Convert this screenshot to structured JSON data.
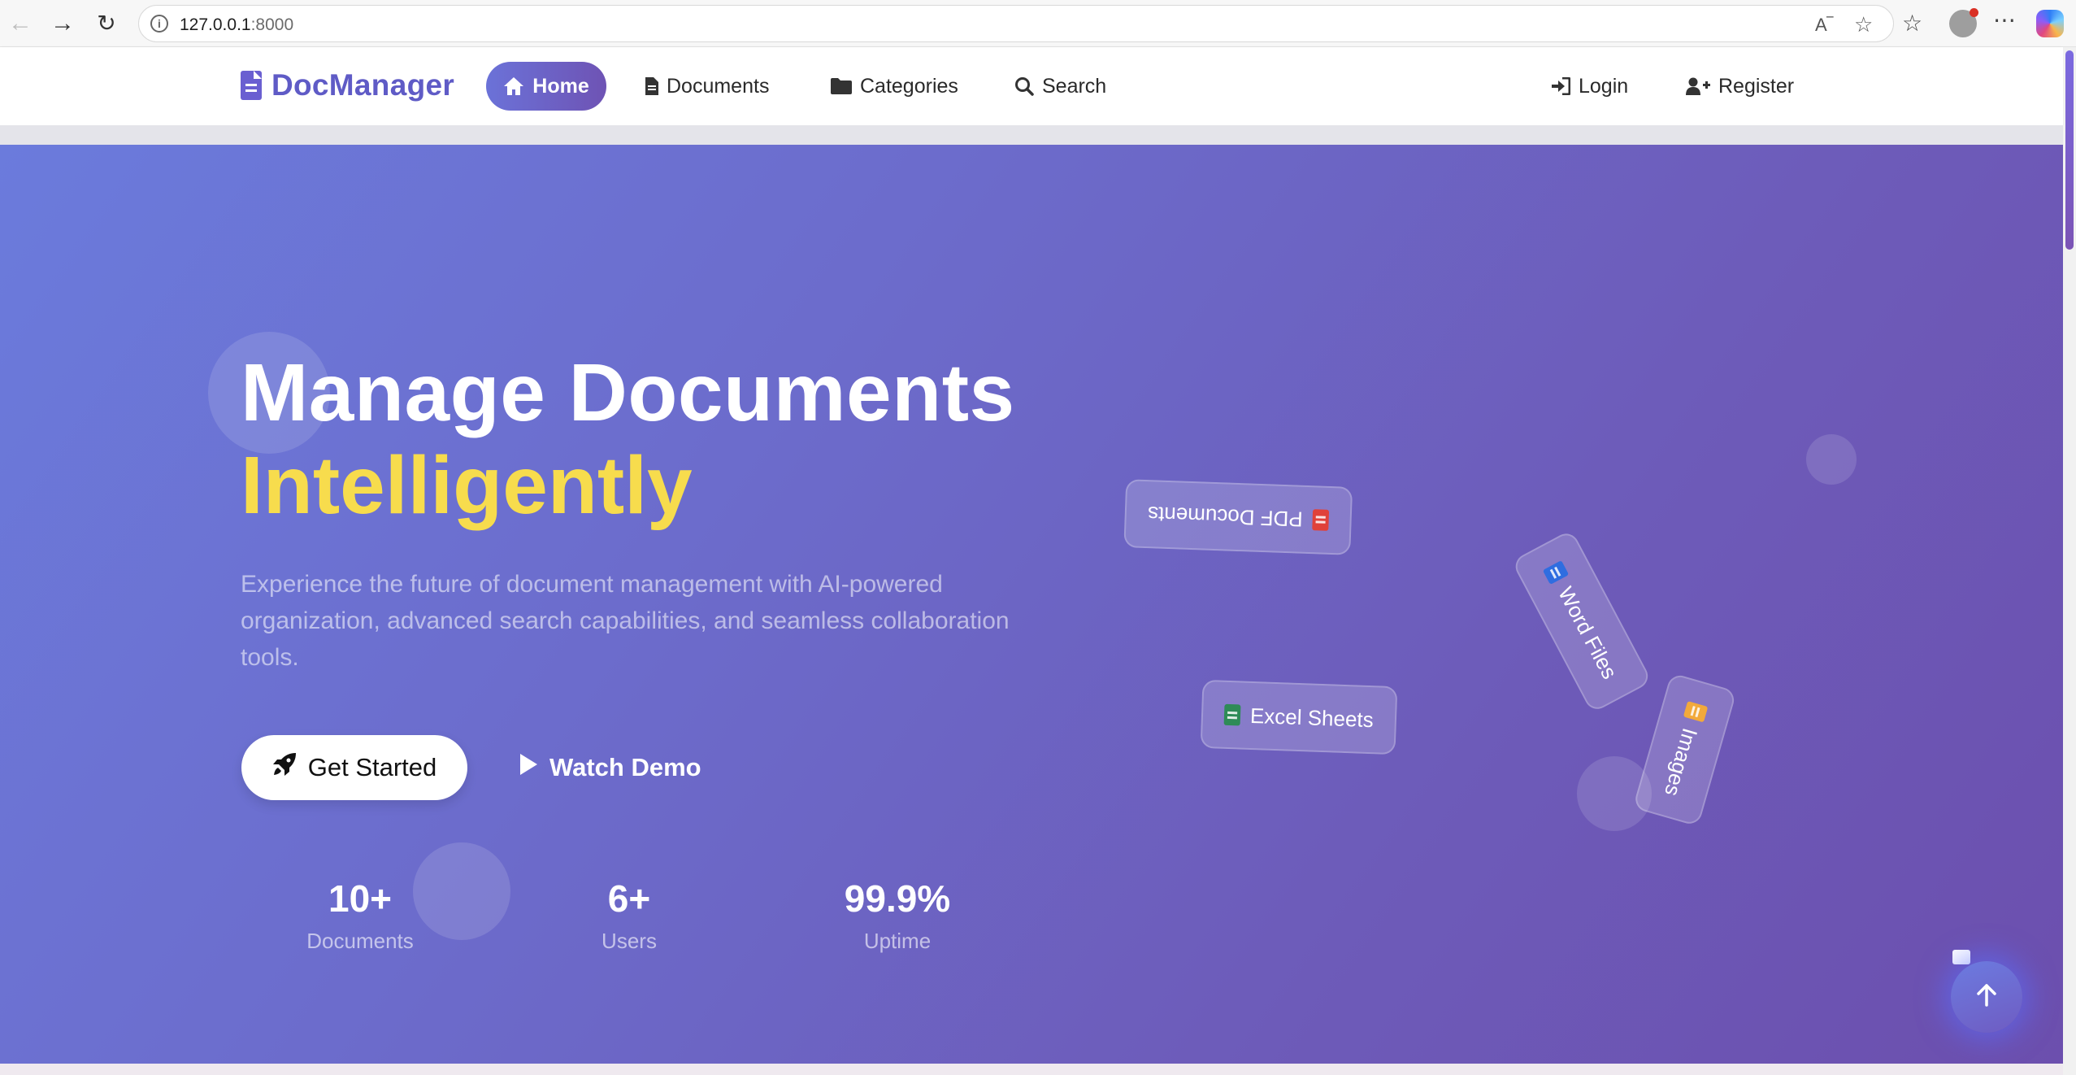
{
  "browser": {
    "url_host": "127.0.0.1",
    "url_port": ":8000",
    "back_icon": "arrow-left-icon",
    "forward_icon": "arrow-right-icon",
    "reload_icon": "reload-icon"
  },
  "site": {
    "brand": "DocManager",
    "nav": {
      "home": "Home",
      "documents": "Documents",
      "categories": "Categories",
      "search": "Search",
      "login": "Login",
      "register": "Register"
    }
  },
  "hero": {
    "title_line1": "Manage Documents",
    "title_line2": "Intelligently",
    "subtitle": "Experience the future of document management with AI-powered organization, advanced search capabilities, and seamless collaboration tools.",
    "primary_button": "Get Started",
    "secondary_button": "Watch Demo",
    "stats": [
      {
        "value": "10+",
        "label": "Documents"
      },
      {
        "value": "6+",
        "label": "Users"
      },
      {
        "value": "99.9%",
        "label": "Uptime"
      }
    ],
    "floating_cards": [
      {
        "label": "PDF Documents",
        "icon": "file-pdf-icon",
        "color": "#e0413a"
      },
      {
        "label": "Word Files",
        "icon": "file-word-icon",
        "color": "#2f6de0"
      },
      {
        "label": "Excel Sheets",
        "icon": "file-excel-icon",
        "color": "#2e8b57"
      },
      {
        "label": "Images",
        "icon": "file-image-icon",
        "color": "#f2a93b"
      }
    ]
  },
  "colors": {
    "brand": "#5f5bc6",
    "hero_start": "#6b7bdc",
    "hero_end": "#6c4fae",
    "accent_yellow": "#f7dc4d"
  }
}
